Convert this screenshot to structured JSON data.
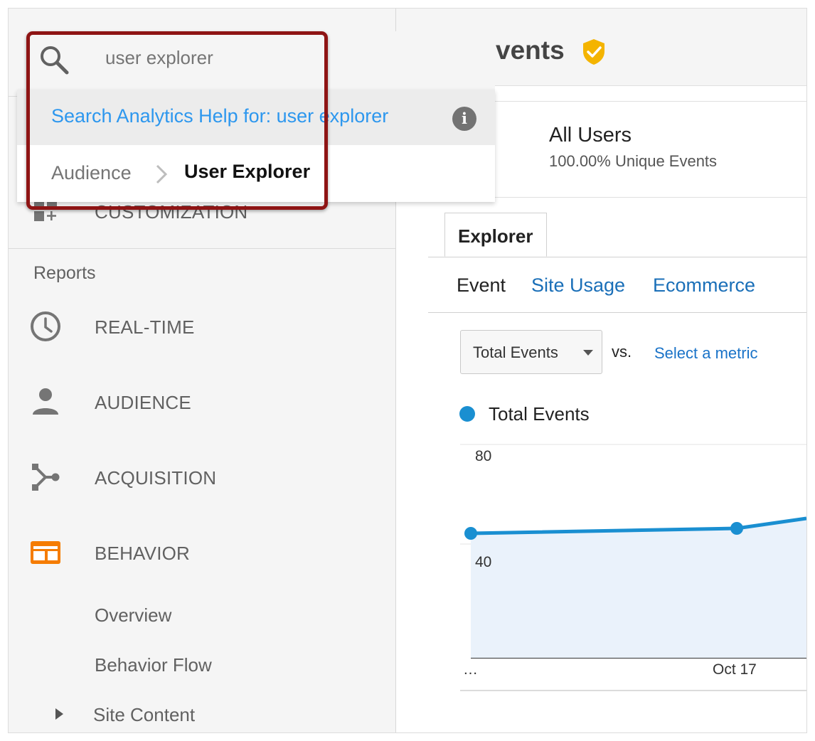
{
  "search": {
    "value": "user explorer",
    "help_text": "Search Analytics Help for: user explorer",
    "result_section": "Audience",
    "result_item": "User Explorer"
  },
  "sidebar": {
    "customization": "CUSTOMIZATION",
    "reports_heading": "Reports",
    "items": [
      {
        "label": "REAL-TIME",
        "icon": "clock-icon"
      },
      {
        "label": "AUDIENCE",
        "icon": "person-icon"
      },
      {
        "label": "ACQUISITION",
        "icon": "acquisition-icon"
      },
      {
        "label": "BEHAVIOR",
        "icon": "behavior-icon"
      }
    ],
    "behavior_subitems": [
      "Overview",
      "Behavior Flow",
      "Site Content"
    ]
  },
  "main": {
    "title": "Top Events",
    "segment": {
      "name": "All Users",
      "subtitle": "100.00% Unique Events"
    },
    "tab": "Explorer",
    "subtabs": [
      "Event",
      "Site Usage",
      "Ecommerce"
    ],
    "metric_select": "Total Events",
    "vs_label": "vs.",
    "select_metric_link": "Select a metric"
  },
  "colors": {
    "accent_blue": "#1a8fd1",
    "link_blue": "#2d97ee",
    "behavior_orange": "#f57c00",
    "highlight_red": "#8e1414",
    "verified_yellow": "#f4b400"
  },
  "chart_data": {
    "type": "area",
    "legend": [
      "Total Events"
    ],
    "series": [
      {
        "name": "Total Events",
        "x": [
          "…",
          "Oct 17",
          ""
        ],
        "values": [
          50,
          52,
          56
        ]
      }
    ],
    "yticks": [
      "80",
      "40"
    ],
    "xticks": [
      "…",
      "Oct 17"
    ],
    "ylim": [
      0,
      88
    ],
    "grid": true
  }
}
